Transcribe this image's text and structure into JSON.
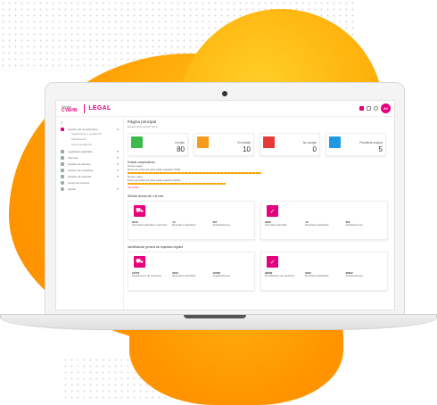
{
  "app": {
    "brand_small": "Grupo",
    "brand_name": "CYAHN",
    "title": "LEGAL",
    "user_initials": "AV"
  },
  "sidebar": {
    "items": [
      {
        "label": "Gestión del cumplimiento",
        "icon": "document-icon",
        "expanded": true
      },
      {
        "label": "Seguimiento y control NC",
        "sub": true
      },
      {
        "label": "Planificación",
        "sub": true
      },
      {
        "label": "Actos jurisdicción",
        "sub": true
      },
      {
        "label": "Legislación aplicable",
        "icon": "chart-icon"
      },
      {
        "label": "Informes",
        "icon": "chart-icon"
      },
      {
        "label": "Gestión de clientes",
        "icon": "building-icon"
      },
      {
        "label": "Gestión de requisitos",
        "icon": "users-icon"
      },
      {
        "label": "Gestión de usuarios",
        "icon": "user-icon"
      },
      {
        "label": "Grupo de terceros",
        "icon": "circle-icon"
      },
      {
        "label": "Ayuda",
        "icon": "help-icon"
      }
    ]
  },
  "main": {
    "title": "Página principal",
    "crumb": "Estado de la acción tenía",
    "cards": [
      {
        "label": "Cumple",
        "value": "80",
        "color": "#3dba4e"
      },
      {
        "label": "En trámite",
        "value": "10",
        "color": "#f59a1b"
      },
      {
        "label": "No cumple",
        "value": "0",
        "color": "#e53935"
      },
      {
        "label": "Pendiente evaluar",
        "value": "5",
        "color": "#1e9be0"
      }
    ],
    "evaluation": {
      "heading": "Estado cumplimiento",
      "line1": "Grupo Legal",
      "line2": "Envío de informes para cada requisito (72%)",
      "line3": "Grupo Legal",
      "line4": "Envío de informes para cada requisito (65%)",
      "more": "Ver todos"
    },
    "group_heading_1": "Últimas fechas del 4 al mes",
    "group_heading_2": "Identificación general de requisitos legales",
    "group_cards_1": [
      {
        "icon": "car-icon",
        "cols": [
          {
            "v": "2010",
            "t": "Normativa aplicable a vehículos"
          },
          {
            "v": "10",
            "t": "Requisitos aplicables"
          },
          {
            "v": "367",
            "t": "Actualizaciones"
          }
        ]
      },
      {
        "icon": "check-icon",
        "cols": [
          {
            "v": "2009",
            "t": "Normativa aplicable"
          },
          {
            "v": "10",
            "t": "Requisitos aplicables"
          },
          {
            "v": "304",
            "t": "Actualizaciones"
          }
        ]
      }
    ],
    "group_cards_2": [
      {
        "icon": "car-icon",
        "cols": [
          {
            "v": "15472",
            "t": "Identificación de requisitos"
          },
          {
            "v": "5610",
            "t": "Requisitos aplicables"
          },
          {
            "v": "10798",
            "t": "Actualizaciones"
          }
        ]
      },
      {
        "icon": "check-icon",
        "cols": [
          {
            "v": "29230",
            "t": "Identificación de requisitos"
          },
          {
            "v": "6012",
            "t": "Requisitos aplicables"
          },
          {
            "v": "29547",
            "t": "Actualizaciones"
          }
        ]
      }
    ]
  }
}
